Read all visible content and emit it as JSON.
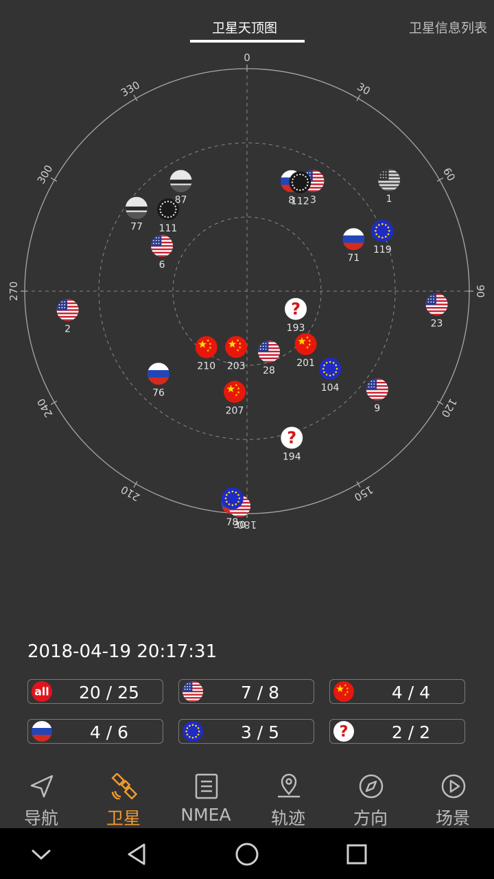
{
  "tabs": {
    "sky_view": "卫星天顶图",
    "sat_list": "卫星信息列表"
  },
  "skyplot": {
    "azimuth_labels": [
      "0",
      "30",
      "60",
      "90",
      "120",
      "150",
      "180",
      "210",
      "240",
      "270",
      "300",
      "330"
    ],
    "satellites": [
      {
        "id": "1",
        "flag": "usa-gray",
        "az": 52,
        "el": 17
      },
      {
        "id": "3",
        "flag": "usa",
        "az": 31,
        "el": 38
      },
      {
        "id": "8",
        "flag": "russia",
        "az": 22,
        "el": 42
      },
      {
        "id": "112",
        "flag": "dotted",
        "az": 26,
        "el": 41
      },
      {
        "id": "87",
        "flag": "gray",
        "az": 329,
        "el": 38
      },
      {
        "id": "111",
        "flag": "dotted",
        "az": 316,
        "el": 44
      },
      {
        "id": "77",
        "flag": "gray",
        "az": 307,
        "el": 34
      },
      {
        "id": "6",
        "flag": "usa",
        "az": 298,
        "el": 51
      },
      {
        "id": "119",
        "flag": "eu",
        "az": 66,
        "el": 30
      },
      {
        "id": "71",
        "flag": "russia",
        "az": 64,
        "el": 42
      },
      {
        "id": "23",
        "flag": "usa",
        "az": 94,
        "el": 13
      },
      {
        "id": "2",
        "flag": "usa",
        "az": 264,
        "el": 17
      },
      {
        "id": "193",
        "flag": "unknown",
        "az": 110,
        "el": 69
      },
      {
        "id": "210",
        "flag": "china",
        "az": 216,
        "el": 62
      },
      {
        "id": "203",
        "flag": "china",
        "az": 191,
        "el": 67
      },
      {
        "id": "28",
        "flag": "usa",
        "az": 160,
        "el": 64
      },
      {
        "id": "201",
        "flag": "china",
        "az": 132,
        "el": 58
      },
      {
        "id": "104",
        "flag": "eu",
        "az": 133,
        "el": 44
      },
      {
        "id": "76",
        "flag": "russia",
        "az": 227,
        "el": 41
      },
      {
        "id": "9",
        "flag": "usa",
        "az": 127,
        "el": 24
      },
      {
        "id": "207",
        "flag": "china",
        "az": 187,
        "el": 49
      },
      {
        "id": "194",
        "flag": "unknown",
        "az": 163,
        "el": 28
      },
      {
        "id": "78",
        "flag": "russia",
        "az": 184,
        "el": 4
      },
      {
        "id": "30",
        "flag": "usa",
        "az": 182,
        "el": 3
      },
      {
        "id": "",
        "flag": "eu",
        "az": 184,
        "el": 6
      }
    ]
  },
  "datetime": "2018-04-19  20:17:31",
  "stats": [
    {
      "badge": "all",
      "value": "20 / 25"
    },
    {
      "badge": "usa",
      "value": "7 / 8"
    },
    {
      "badge": "china",
      "value": "4 / 4"
    },
    {
      "badge": "russia",
      "value": "4 / 6"
    },
    {
      "badge": "eu",
      "value": "3 / 5"
    },
    {
      "badge": "unknown",
      "value": "2 / 2"
    }
  ],
  "badge_all_text": "all",
  "nav": [
    {
      "label": "导航",
      "icon": "navigation-arrow-icon"
    },
    {
      "label": "卫星",
      "icon": "satellite-icon"
    },
    {
      "label": "NMEA",
      "icon": "nmea-document-icon"
    },
    {
      "label": "轨迹",
      "icon": "track-pin-icon"
    },
    {
      "label": "方向",
      "icon": "compass-icon"
    },
    {
      "label": "场景",
      "icon": "play-scene-icon"
    }
  ],
  "nav_active": "卫星",
  "colors": {
    "accent": "#f39a2c",
    "background": "#333333"
  }
}
